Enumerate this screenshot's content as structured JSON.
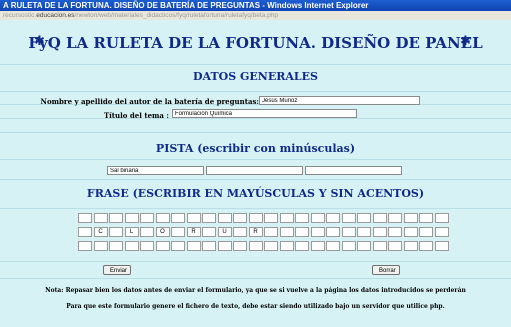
{
  "window": {
    "title": "A RULETA DE LA FORTUNA. DISEÑO DE BATERÍA DE PREGUNTAS - Windows Internet Explorer",
    "url_prefix": "recursostic.",
    "url_domain": "educacion.es",
    "url_rest": "/newton/web/materiales_didacticos/fyq/ruletafortuna/ruletafyq/beta.php"
  },
  "header": {
    "title": "FyQ LA RULETA DE LA FORTUNA. DISEÑO DE PANEL",
    "star_left": "✱",
    "star_right": "✱"
  },
  "datos": {
    "heading": "DATOS GENERALES",
    "author_label": "Nombre y apellido del autor de la batería de preguntas:",
    "author_value": "Jesús Muñoz",
    "topic_label": "Título del tema :",
    "topic_value": "Formulación Química"
  },
  "pista": {
    "heading": "PISTA (escribir con minúsculas)",
    "values": [
      "Sal binaria",
      "",
      ""
    ]
  },
  "frase": {
    "heading": "FRASE (ESCRIBIR EN MAYÚSCULAS Y SIN ACENTOS)",
    "rows": [
      [
        "",
        "",
        "",
        "",
        "",
        "",
        "",
        "",
        "",
        "",
        "",
        "",
        "",
        "",
        "",
        "",
        "",
        "",
        "",
        "",
        "",
        "",
        "",
        ""
      ],
      [
        "",
        "C",
        "",
        "L",
        "",
        "O",
        "",
        "R",
        "",
        "U",
        "",
        "R",
        "",
        "",
        "",
        "",
        "",
        "",
        "",
        "",
        "",
        "",
        "",
        ""
      ],
      [
        "",
        "",
        "",
        "",
        "",
        "",
        "",
        "",
        "",
        "",
        "",
        "",
        "",
        "",
        "",
        "",
        "",
        "",
        "",
        "",
        "",
        "",
        "",
        ""
      ]
    ]
  },
  "buttons": {
    "submit": "Enviar",
    "reset": "Borrar"
  },
  "notes": {
    "note1": "Nota: Repasar bien los datos antes de enviar el formulario, ya que se si vuelve a la página los datos introducidos se perderán",
    "note2": "Para que este formulario genere el fichero de texto, debe estar siendo utilizado bajo un servidor que utilice php."
  }
}
